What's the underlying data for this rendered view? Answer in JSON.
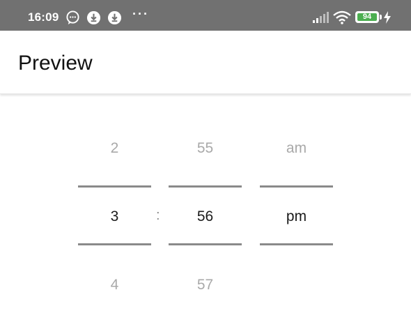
{
  "status_bar": {
    "time": "16:09",
    "battery": "94",
    "icons": [
      "chat-bubble-icon",
      "download-icon",
      "download-icon",
      "more-dots-icon",
      "signal-icon",
      "wifi-icon",
      "battery-icon",
      "charging-icon"
    ],
    "dots": "···",
    "battery_color": "#4caf50"
  },
  "app_bar": {
    "title": "Preview"
  },
  "time_picker": {
    "hour": {
      "prev": "2",
      "selected": "3",
      "next": "4"
    },
    "separator": ":",
    "minute": {
      "prev": "55",
      "selected": "56",
      "next": "57"
    },
    "period": {
      "prev": "am",
      "selected": "pm",
      "next": ""
    },
    "divider_color": "#8a8a8a"
  }
}
